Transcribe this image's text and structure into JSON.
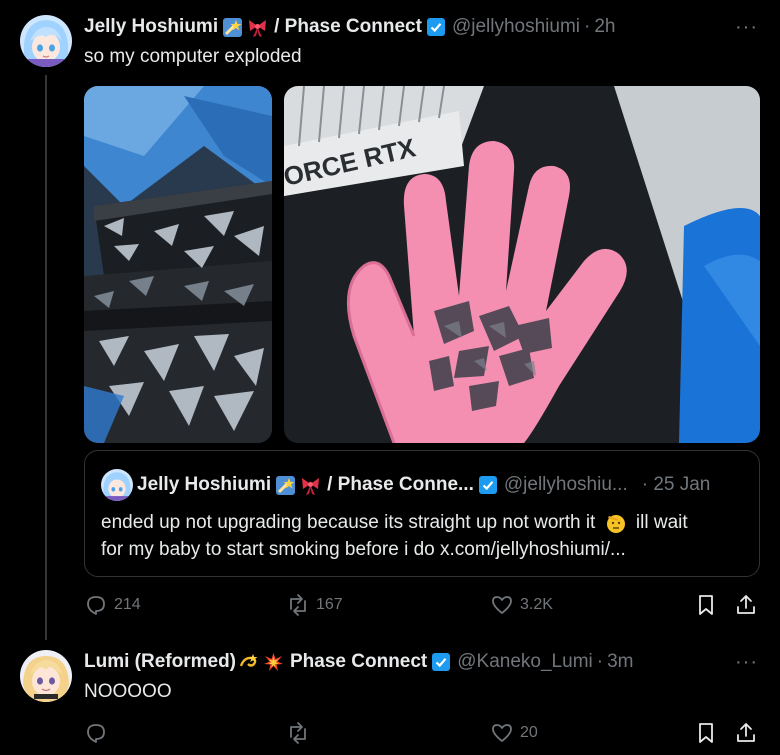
{
  "tweet1": {
    "name": "Jelly Hoshiumi",
    "affiliation": "/ Phase Connect",
    "handle": "@jellyhoshiumi",
    "time": "2h",
    "text": "so my computer exploded",
    "more": "···",
    "images": [
      {
        "icon": "shattered-glass-in-case-photo"
      },
      {
        "icon": "pink-gloved-hand-with-glass-photo",
        "visible_text": "ORCE RTX"
      }
    ],
    "quote": {
      "name": "Jelly Hoshiumi",
      "affiliation": "/ Phase Conne...",
      "handle": "@jellyhoshiu...",
      "time": "· 25 Jan",
      "line1": "ended up not upgrading because its straight up not worth it",
      "line1_after": "ill wait",
      "line2": "for my baby to start smoking before i do x.com/jellyhoshiumi/..."
    },
    "stats": {
      "replies": "214",
      "reposts": "167",
      "likes": "3.2K"
    }
  },
  "tweet2": {
    "name": "Lumi (Reformed)",
    "affiliation": "Phase Connect",
    "handle": "@Kaneko_Lumi",
    "time": "3m",
    "text": "NOOOOO",
    "more": "···",
    "stats": {
      "replies": "",
      "reposts": "",
      "likes": "20"
    }
  },
  "colors": {
    "background": "#000000",
    "text": "#e7e9ea",
    "muted": "#71767b",
    "border": "#2f3336",
    "verified": "#1d9bf0"
  }
}
